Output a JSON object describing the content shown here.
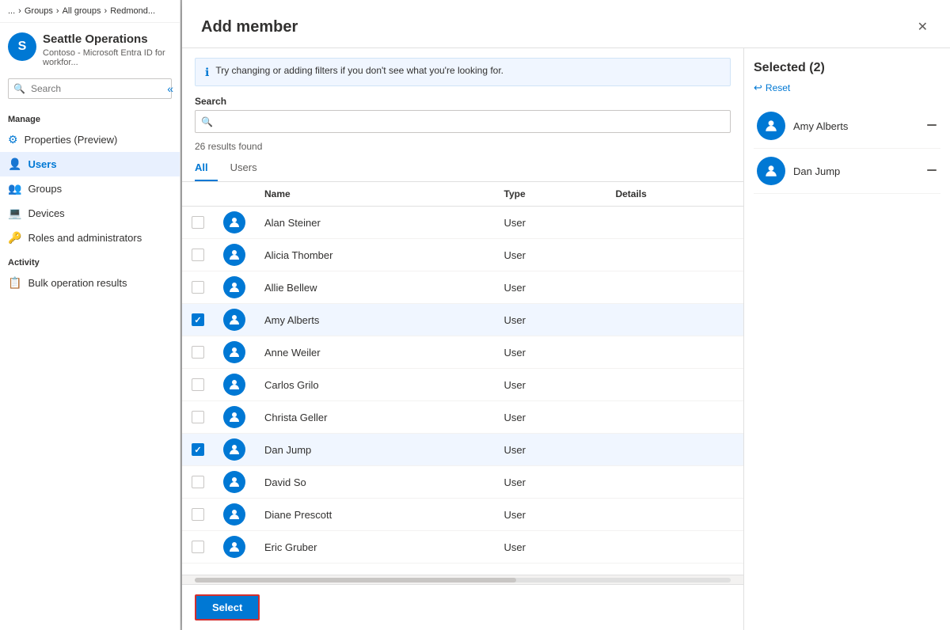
{
  "sidebar": {
    "breadcrumb": {
      "dots": "...",
      "groups": "Groups",
      "all_groups": "All groups",
      "current": "Redmond..."
    },
    "org": {
      "initials": "S",
      "name": "Seattle Operations",
      "subtitle": "Contoso - Microsoft Entra ID for workfor..."
    },
    "search_placeholder": "Search",
    "collapse_icon": "«",
    "manage_label": "Manage",
    "items_manage": [
      {
        "id": "properties",
        "label": "Properties (Preview)",
        "icon": "⚙",
        "icon_color": "blue"
      },
      {
        "id": "users",
        "label": "Users",
        "icon": "👤",
        "icon_color": "blue",
        "active": true
      },
      {
        "id": "groups",
        "label": "Groups",
        "icon": "👥",
        "icon_color": "blue"
      },
      {
        "id": "devices",
        "label": "Devices",
        "icon": "💻",
        "icon_color": "blue"
      },
      {
        "id": "roles",
        "label": "Roles and administrators",
        "icon": "🔑",
        "icon_color": "green"
      }
    ],
    "activity_label": "Activity",
    "items_activity": [
      {
        "id": "bulk",
        "label": "Bulk operation results",
        "icon": "📋",
        "icon_color": "green"
      }
    ]
  },
  "modal": {
    "title": "Add member",
    "close_icon": "✕",
    "info_banner": "Try changing or adding filters if you don't see what you're looking for.",
    "search_label": "Search",
    "search_placeholder": "",
    "results_count": "26 results found",
    "tabs": [
      {
        "id": "all",
        "label": "All",
        "active": true
      },
      {
        "id": "users",
        "label": "Users",
        "active": false
      }
    ],
    "table": {
      "columns": [
        "",
        "",
        "Name",
        "Type",
        "Details"
      ],
      "rows": [
        {
          "id": 1,
          "name": "Alan Steiner",
          "type": "User",
          "checked": false
        },
        {
          "id": 2,
          "name": "Alicia Thomber",
          "type": "User",
          "checked": false
        },
        {
          "id": 3,
          "name": "Allie Bellew",
          "type": "User",
          "checked": false
        },
        {
          "id": 4,
          "name": "Amy Alberts",
          "type": "User",
          "checked": true
        },
        {
          "id": 5,
          "name": "Anne Weiler",
          "type": "User",
          "checked": false
        },
        {
          "id": 6,
          "name": "Carlos Grilo",
          "type": "User",
          "checked": false
        },
        {
          "id": 7,
          "name": "Christa Geller",
          "type": "User",
          "checked": false
        },
        {
          "id": 8,
          "name": "Dan Jump",
          "type": "User",
          "checked": true
        },
        {
          "id": 9,
          "name": "David So",
          "type": "User",
          "checked": false
        },
        {
          "id": 10,
          "name": "Diane Prescott",
          "type": "User",
          "checked": false
        },
        {
          "id": 11,
          "name": "Eric Gruber",
          "type": "User",
          "checked": false
        }
      ]
    },
    "select_button": "Select",
    "selected": {
      "header": "Selected (2)",
      "reset_label": "Reset",
      "items": [
        {
          "id": 1,
          "name": "Amy Alberts"
        },
        {
          "id": 2,
          "name": "Dan Jump"
        }
      ]
    }
  }
}
